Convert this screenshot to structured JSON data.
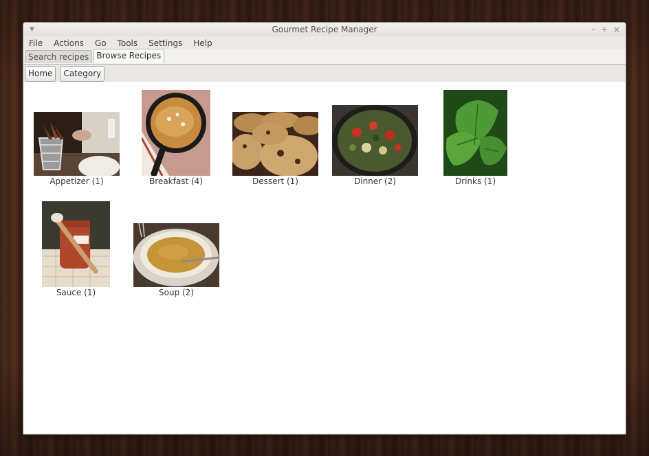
{
  "window": {
    "title": "Gourmet Recipe Manager",
    "controls": [
      "–",
      "+",
      "×"
    ]
  },
  "menu": [
    "File",
    "Actions",
    "Go",
    "Tools",
    "Settings",
    "Help"
  ],
  "tabs": [
    {
      "label": "Search recipes",
      "active": false
    },
    {
      "label": "Browse Recipes",
      "active": true
    }
  ],
  "nav": {
    "home": "Home",
    "category": "Category"
  },
  "categories": [
    {
      "label": "Appetizer (1)",
      "icon": "appetizer-photo"
    },
    {
      "label": "Breakfast (4)",
      "icon": "breakfast-photo"
    },
    {
      "label": "Dessert (1)",
      "icon": "dessert-photo"
    },
    {
      "label": "Dinner (2)",
      "icon": "dinner-photo"
    },
    {
      "label": "Drinks (1)",
      "icon": "drinks-photo"
    },
    {
      "label": "Sauce (1)",
      "icon": "sauce-photo"
    },
    {
      "label": "Soup (2)",
      "icon": "soup-photo"
    }
  ]
}
